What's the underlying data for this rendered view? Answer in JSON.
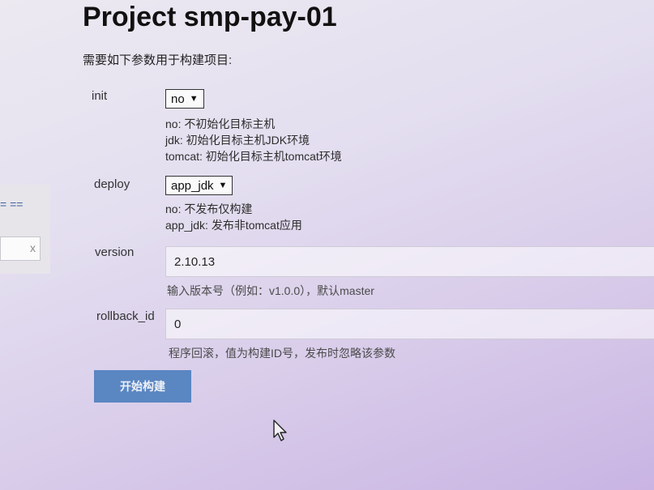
{
  "page": {
    "title": "Project smp-pay-01",
    "intro": "需要如下参数用于构建项目:"
  },
  "side": {
    "clear_symbol": "x",
    "eq_symbol": "= =="
  },
  "params": {
    "init": {
      "label": "init",
      "selected": "no",
      "help": [
        "no: 不初始化目标主机",
        "jdk: 初始化目标主机JDK环境",
        "tomcat: 初始化目标主机tomcat环境"
      ]
    },
    "deploy": {
      "label": "deploy",
      "selected": "app_jdk",
      "help": [
        "no: 不发布仅构建",
        "app_jdk: 发布非tomcat应用"
      ]
    },
    "version": {
      "label": "version",
      "value": "2.10.13",
      "help": "输入版本号（例如：v1.0.0），默认master"
    },
    "rollback_id": {
      "label": "rollback_id",
      "value": "0",
      "help": "程序回滚，值为构建ID号，发布时忽略该参数"
    }
  },
  "actions": {
    "build_label": "开始构建"
  },
  "icons": {
    "select_caret": "triangle-down",
    "cursor": "mouse-pointer"
  },
  "colors": {
    "button": "#5a86c2",
    "side_accent": "#3b5fa0"
  }
}
